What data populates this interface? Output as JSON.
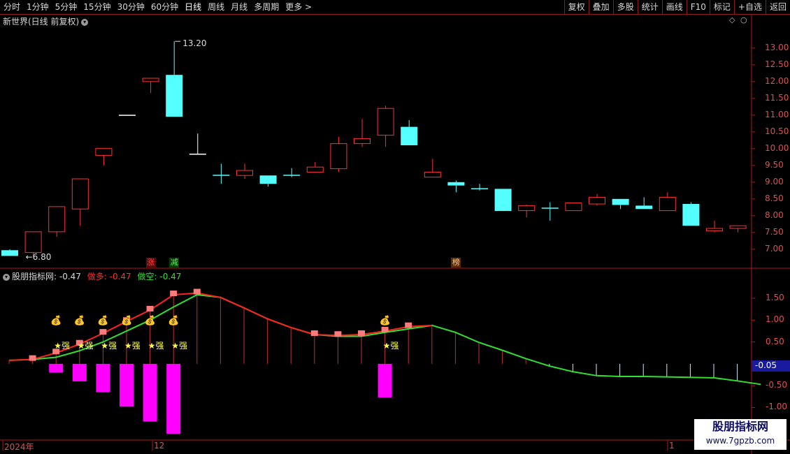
{
  "toolbar": {
    "periods": [
      "分时",
      "1分钟",
      "5分钟",
      "15分钟",
      "30分钟",
      "60分钟",
      "日线",
      "周线",
      "月线",
      "多周期",
      "更多 >"
    ],
    "active_period": "日线",
    "actions": [
      "复权",
      "叠加",
      "多股",
      "统计",
      "画线",
      "F10",
      "标记",
      "+自选",
      "返回"
    ]
  },
  "main_panel": {
    "title": "新世界(日线 前复权)",
    "high_label": "13.20",
    "low_label": "6.80",
    "tags": [
      {
        "text": "涨",
        "color": "#ff4040",
        "bg": "#5a0a0a",
        "index": 6
      },
      {
        "text": "减",
        "color": "#40ff40",
        "bg": "#0a3a0a",
        "index": 7
      },
      {
        "text": "榜",
        "color": "#ffd080",
        "bg": "#5a2a0a",
        "index": 19
      }
    ]
  },
  "sub_panel": {
    "title": "股朋指标网",
    "value": ": -0.47",
    "long_label": "做多: -0.47",
    "short_label": "做空: -0.47",
    "current_value": "-0.05",
    "star_label": "★强",
    "bag_icon": "money-bag-icon"
  },
  "yaxis_main": [
    "13.00",
    "12.50",
    "12.00",
    "11.50",
    "11.00",
    "10.50",
    "10.00",
    "9.50",
    "9.00",
    "8.50",
    "8.00",
    "7.50",
    "7.00"
  ],
  "yaxis_sub": [
    "1.50",
    "1.00",
    "0.50",
    "-0.50",
    "-1.00"
  ],
  "xaxis": [
    "2024年",
    "12",
    "1"
  ],
  "watermark": {
    "title": "股朋指标网",
    "url": "www.7gpzb.com"
  },
  "colors": {
    "up": "#ff3030",
    "down": "#54ffff",
    "axis": "#b01818",
    "long_line": "#ff2020",
    "short_line": "#30e030",
    "bar_neg": "#ff00ff",
    "bar_pos_box": "#ff7a7a"
  },
  "chart_data": {
    "type": "candlestick",
    "ylim": [
      6.6,
      13.6
    ],
    "candles": [
      {
        "o": 6.97,
        "c": 6.8,
        "h": 7.0,
        "l": 6.8
      },
      {
        "o": 6.9,
        "c": 7.52,
        "h": 7.52,
        "l": 6.8
      },
      {
        "o": 7.52,
        "c": 8.27,
        "h": 8.27,
        "l": 7.37
      },
      {
        "o": 8.2,
        "c": 9.1,
        "h": 9.1,
        "l": 7.7
      },
      {
        "o": 9.8,
        "c": 10.01,
        "h": 10.01,
        "l": 9.5
      },
      {
        "o": 11.01,
        "c": 11.01,
        "h": 11.01,
        "l": 11.01
      },
      {
        "o": 12.0,
        "c": 12.1,
        "h": 12.1,
        "l": 11.66
      },
      {
        "o": 12.2,
        "c": 10.95,
        "h": 13.2,
        "l": 10.95
      },
      {
        "o": 9.85,
        "c": 9.85,
        "h": 10.45,
        "l": 9.85
      },
      {
        "o": 9.22,
        "c": 9.22,
        "h": 9.55,
        "l": 8.95
      },
      {
        "o": 9.2,
        "c": 9.35,
        "h": 9.55,
        "l": 9.1
      },
      {
        "o": 9.2,
        "c": 8.95,
        "h": 9.2,
        "l": 8.87
      },
      {
        "o": 9.22,
        "c": 9.22,
        "h": 9.42,
        "l": 9.15
      },
      {
        "o": 9.3,
        "c": 9.45,
        "h": 9.6,
        "l": 9.3
      },
      {
        "o": 9.4,
        "c": 10.15,
        "h": 10.35,
        "l": 9.3
      },
      {
        "o": 10.15,
        "c": 10.3,
        "h": 10.88,
        "l": 10.05
      },
      {
        "o": 10.4,
        "c": 11.2,
        "h": 11.28,
        "l": 10.05
      },
      {
        "o": 10.65,
        "c": 10.1,
        "h": 10.85,
        "l": 10.1
      },
      {
        "o": 9.15,
        "c": 9.3,
        "h": 9.7,
        "l": 9.15
      },
      {
        "o": 9.0,
        "c": 8.9,
        "h": 9.05,
        "l": 8.7
      },
      {
        "o": 8.82,
        "c": 8.82,
        "h": 8.95,
        "l": 8.75
      },
      {
        "o": 8.8,
        "c": 8.14,
        "h": 8.8,
        "l": 8.14
      },
      {
        "o": 8.15,
        "c": 8.3,
        "h": 8.33,
        "l": 7.95
      },
      {
        "o": 8.24,
        "c": 8.24,
        "h": 8.4,
        "l": 7.85
      },
      {
        "o": 8.15,
        "c": 8.38,
        "h": 8.38,
        "l": 8.15
      },
      {
        "o": 8.35,
        "c": 8.55,
        "h": 8.65,
        "l": 8.3
      },
      {
        "o": 8.5,
        "c": 8.32,
        "h": 8.5,
        "l": 8.2
      },
      {
        "o": 8.3,
        "c": 8.2,
        "h": 8.55,
        "l": 8.2
      },
      {
        "o": 8.15,
        "c": 8.55,
        "h": 8.7,
        "l": 8.15
      },
      {
        "o": 8.35,
        "c": 7.7,
        "h": 8.4,
        "l": 7.7
      },
      {
        "o": 7.55,
        "c": 7.62,
        "h": 7.85,
        "l": 7.5
      },
      {
        "o": 7.62,
        "c": 7.7,
        "h": 7.7,
        "l": 7.5
      }
    ],
    "sub_ylim": [
      -1.2,
      1.9
    ],
    "long_line": [
      0.08,
      0.1,
      0.25,
      0.45,
      0.7,
      0.97,
      1.23,
      1.58,
      1.62,
      1.52,
      1.28,
      1.03,
      0.83,
      0.67,
      0.65,
      0.67,
      0.75,
      0.85,
      0.88,
      0.72,
      0.49,
      0.31,
      0.12,
      -0.05,
      -0.18,
      -0.27,
      -0.29,
      -0.29,
      -0.3,
      -0.31,
      -0.32,
      -0.39,
      -0.47
    ],
    "short_line": [
      0.08,
      0.1,
      0.15,
      0.3,
      0.5,
      0.75,
      1.0,
      1.3,
      1.58,
      1.52,
      1.28,
      1.03,
      0.83,
      0.67,
      0.63,
      0.63,
      0.72,
      0.8,
      0.88,
      0.72,
      0.49,
      0.31,
      0.12,
      -0.05,
      -0.18,
      -0.27,
      -0.29,
      -0.29,
      -0.3,
      -0.31,
      -0.32,
      -0.39,
      -0.47
    ],
    "neg_bars": {
      "2": -0.2,
      "3": -0.4,
      "4": -0.65,
      "5": -0.98,
      "6": -1.32,
      "7": -1.6,
      "16": -0.77
    },
    "marker_indices": [
      1,
      2,
      3,
      4,
      5,
      6,
      7,
      8,
      13,
      14,
      15,
      16,
      17
    ],
    "bag_indices": [
      2,
      3,
      4,
      5,
      6,
      7,
      16
    ],
    "star_indices": [
      2,
      3,
      4,
      5,
      6,
      7,
      16
    ]
  }
}
